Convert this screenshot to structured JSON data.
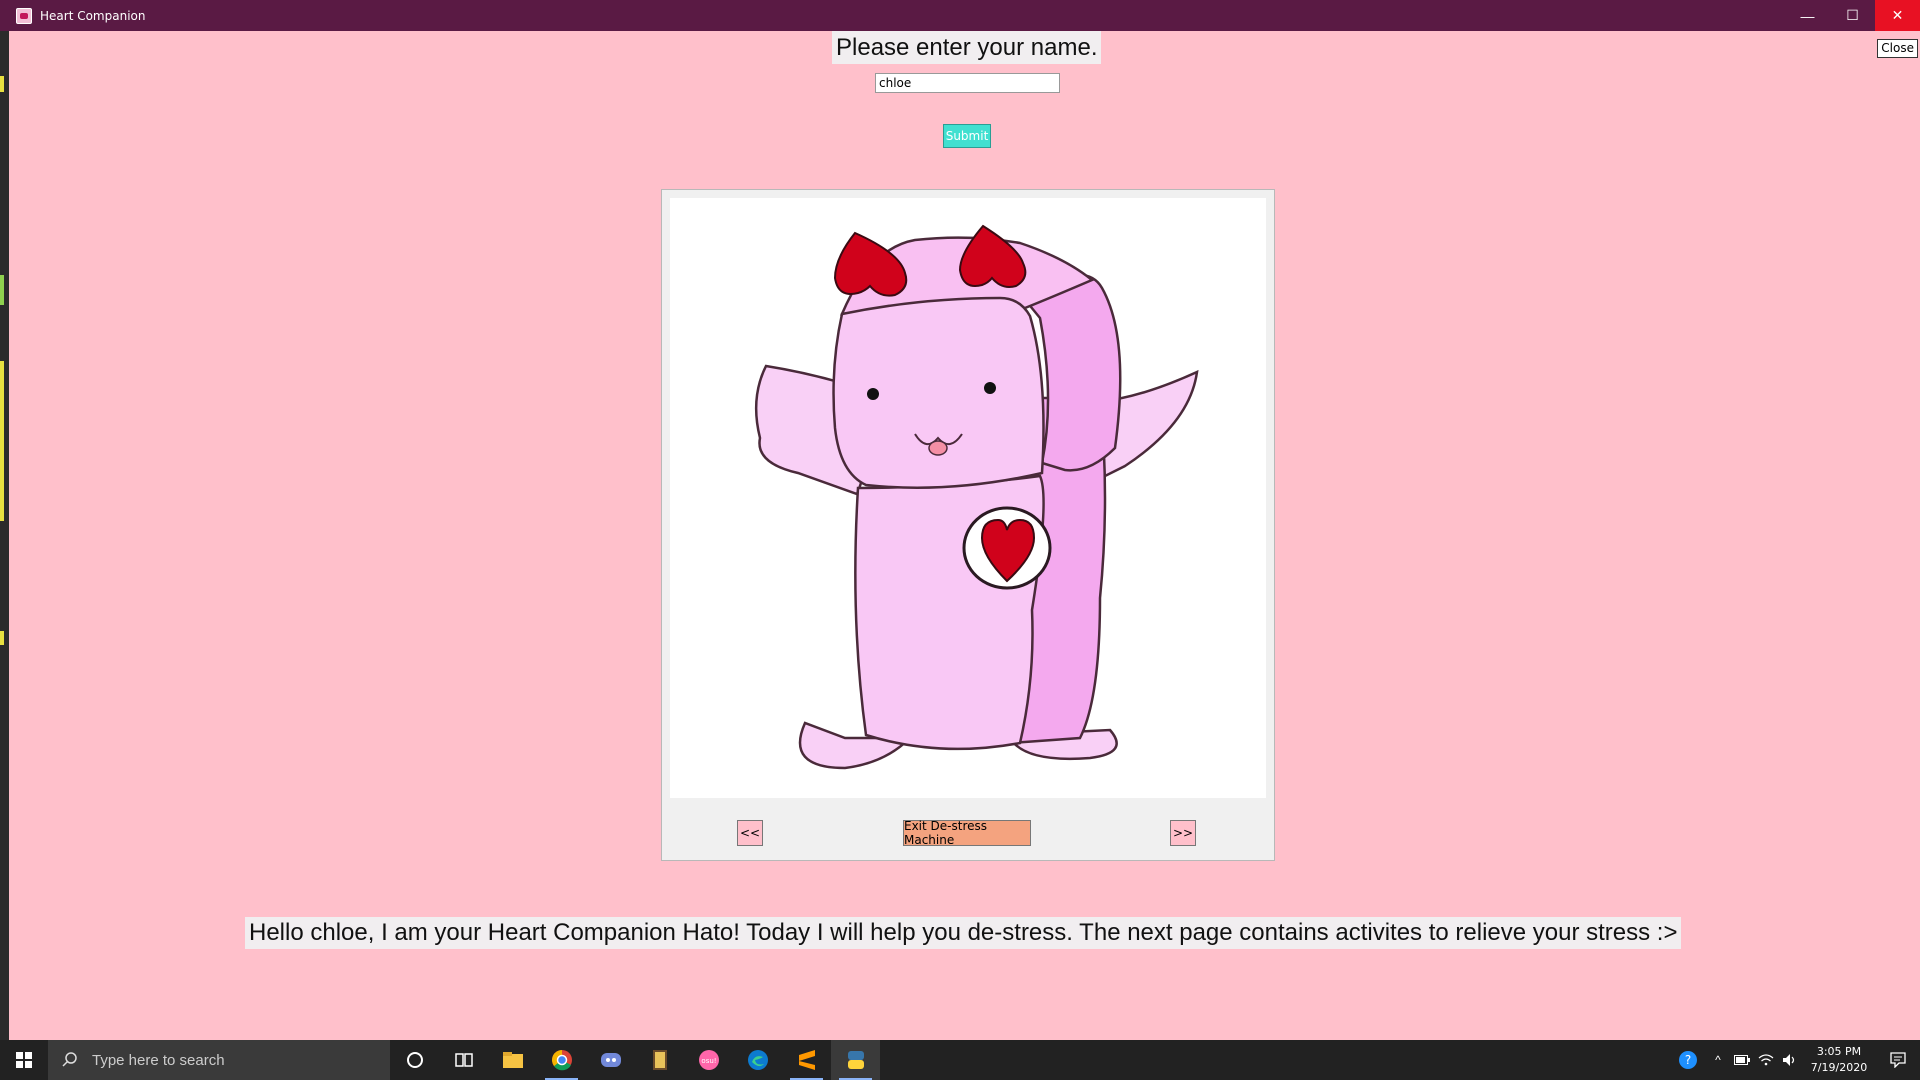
{
  "window": {
    "title": "Heart Companion"
  },
  "close_button": "Close",
  "prompt": "Please enter your name.",
  "name_input": {
    "value": "chloe"
  },
  "submit_label": "Submit",
  "carousel": {
    "prev_label": "<<",
    "exit_label": "Exit De-stress Machine",
    "next_label": ">>"
  },
  "message": "Hello chloe, I am your Heart Companion Hato! Today I will help you de-stress. The next page contains activites to relieve your stress :>",
  "taskbar": {
    "search_placeholder": "Type here to search",
    "apps": [
      "cortana-icon",
      "task-view-icon",
      "file-explorer-icon",
      "chrome-icon",
      "discord-icon",
      "minecraft-icon",
      "osu-icon",
      "edge-icon",
      "sublime-text-icon",
      "python-icon"
    ],
    "clock_time": "3:05 PM",
    "clock_date": "7/19/2020"
  },
  "colors": {
    "background": "#ffc0cb",
    "titlebar": "#5a1a44",
    "submit": "#40e0d0",
    "exit": "#f4a37f",
    "heart": "#d0021b",
    "character": "#f9c8f5"
  }
}
